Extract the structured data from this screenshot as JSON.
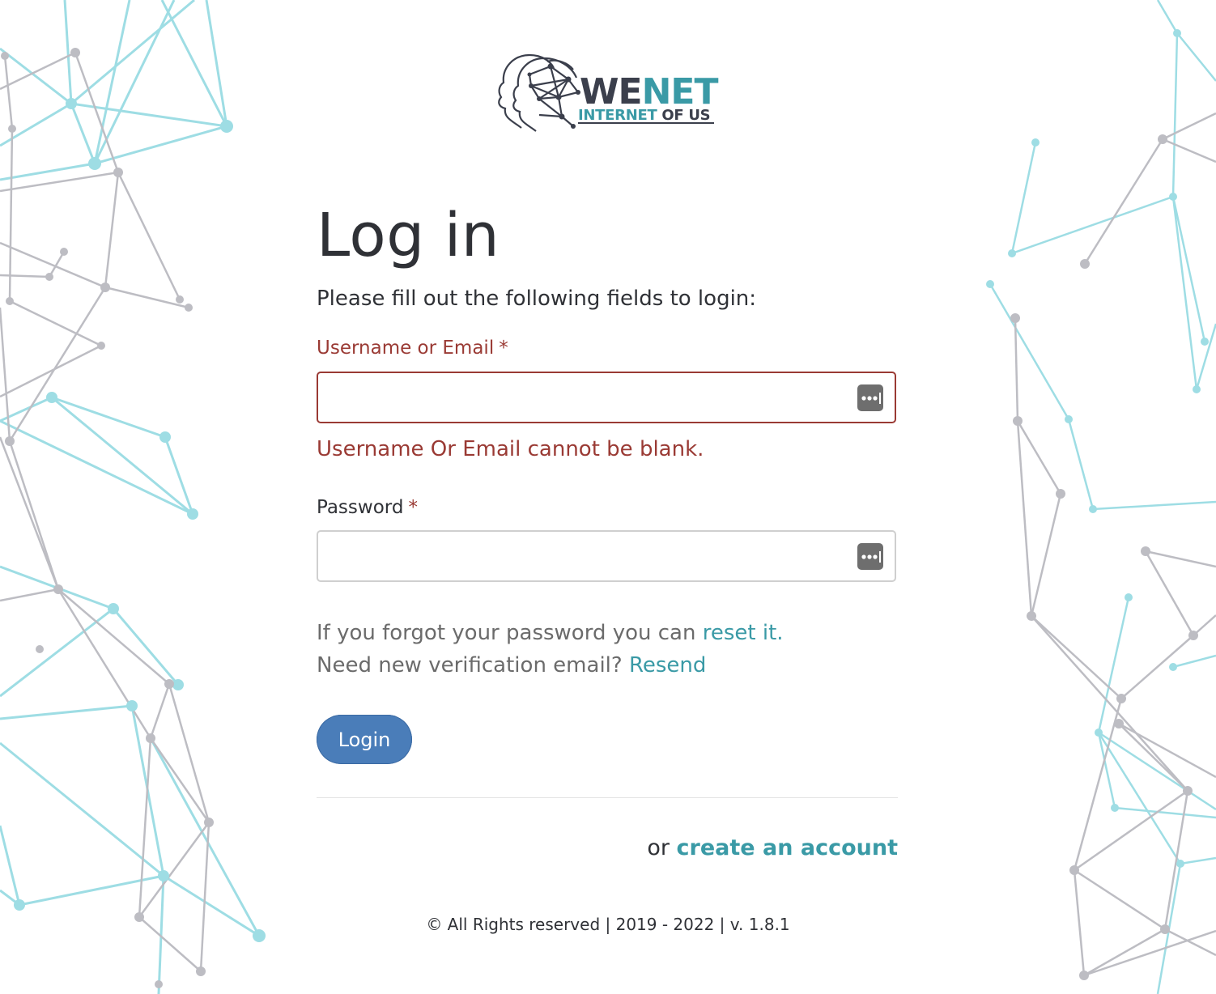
{
  "brand": {
    "name_part1": "WE",
    "name_part2": "NET",
    "tagline_part1": "INTERNET",
    "tagline_part2": "OF US",
    "colors": {
      "dark": "#3b3f4c",
      "teal": "#3a9aa6"
    }
  },
  "login": {
    "title": "Log in",
    "subtitle": "Please fill out the following fields to login:",
    "username_label": "Username or Email",
    "password_label": "Password",
    "required_mark": "*",
    "username_value": "",
    "password_value": "",
    "username_error": "Username Or Email cannot be blank.",
    "forgot_text": "If you forgot your password you can",
    "forgot_link": "reset it.",
    "verify_text": "Need new verification email?",
    "verify_link": "Resend",
    "login_button": "Login",
    "or_text": "or",
    "create_account_link": "create an account"
  },
  "footer": {
    "text": "© All Rights reserved | 2019 - 2022 | v. 1.8.1"
  },
  "icons": {
    "password_manager": "password-key-icon",
    "logo": "wenet-heads-network-logo"
  },
  "theme": {
    "error": "#9a3a34",
    "link": "#3a9aa6",
    "button": "#4a7db9",
    "network_teal": "#9edde4",
    "network_gray": "#bdbdc3"
  }
}
